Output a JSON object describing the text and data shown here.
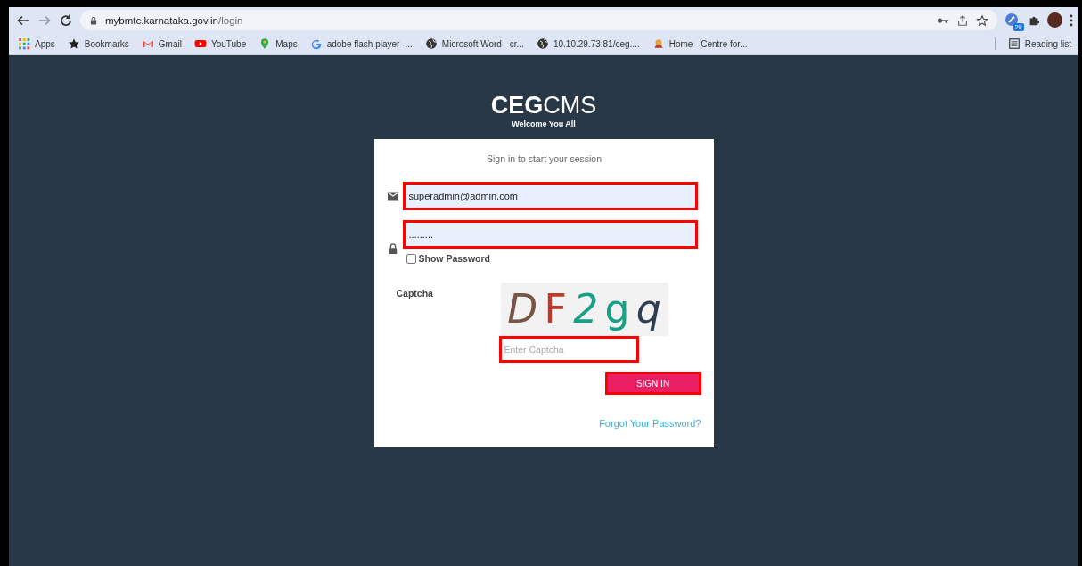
{
  "browser": {
    "url_host": "mybmtc.karnataka.gov.in",
    "url_path": "/login",
    "extension_badge": "2k",
    "bookmarks": [
      {
        "label": "Apps",
        "kind": "apps"
      },
      {
        "label": "Bookmarks",
        "kind": "star"
      },
      {
        "label": "Gmail",
        "kind": "gmail"
      },
      {
        "label": "YouTube",
        "kind": "youtube"
      },
      {
        "label": "Maps",
        "kind": "maps"
      },
      {
        "label": "adobe flash player -...",
        "kind": "google"
      },
      {
        "label": "Microsoft Word - cr...",
        "kind": "globe"
      },
      {
        "label": "10.10.29.73:81/ceg....",
        "kind": "globe"
      },
      {
        "label": "Home - Centre for...",
        "kind": "emblem"
      }
    ],
    "reading_list": "Reading list"
  },
  "brand": {
    "bold": "CEG",
    "regular": "CMS",
    "tagline": "Welcome You All"
  },
  "login": {
    "heading": "Sign in to start your session",
    "email": {
      "value": "superadmin@admin.com",
      "highlighted": true
    },
    "password": {
      "value": ".........",
      "highlighted": true
    },
    "show_password": {
      "label": "Show Password",
      "checked": false
    },
    "captcha_label": "Captcha",
    "captcha_chars": [
      {
        "char": "D",
        "color": "#795548"
      },
      {
        "char": "F",
        "color": "#c0392b"
      },
      {
        "char": "2",
        "color": "#16a085"
      },
      {
        "char": "g",
        "color": "#16a085"
      },
      {
        "char": "q",
        "color": "#2c3e50"
      }
    ],
    "captcha_input": {
      "placeholder": "Enter Captcha",
      "highlighted": true
    },
    "sign_in": {
      "label": "SIGN IN",
      "highlighted": true
    },
    "forgot": "Forgot Your Password?"
  }
}
